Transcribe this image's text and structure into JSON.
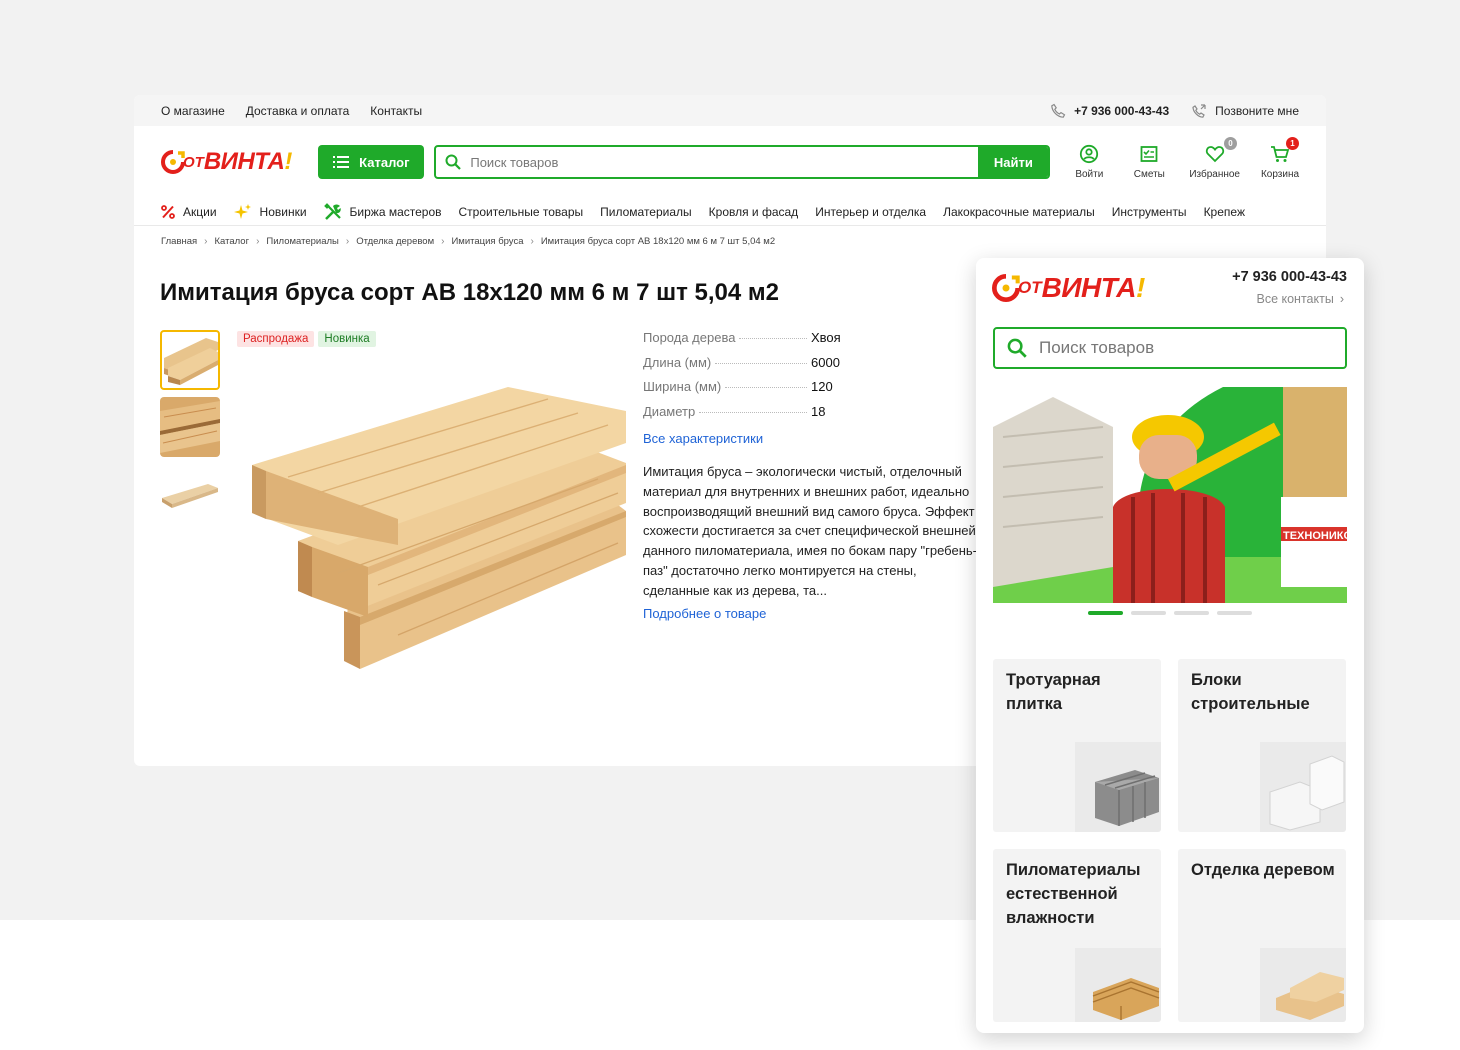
{
  "desktop": {
    "topbar": {
      "links": [
        "О магазине",
        "Доставка и оплата",
        "Контакты"
      ],
      "phone": "+7 936 000-43-43",
      "callback": "Позвоните мне"
    },
    "header": {
      "logo": {
        "ot": "ОТ",
        "vinta": "ВИНТА",
        "excl": "!"
      },
      "catalog_label": "Каталог",
      "search_placeholder": "Поиск товаров",
      "find_label": "Найти",
      "actions": {
        "login": "Войти",
        "estimates": "Сметы",
        "favorites": "Избранное",
        "favorites_count": "0",
        "cart": "Корзина",
        "cart_count": "1"
      }
    },
    "nav": {
      "promo": "Акции",
      "news": "Новинки",
      "masters": "Биржа мастеров",
      "items": [
        "Строительные товары",
        "Пиломатериалы",
        "Кровля и фасад",
        "Интерьер и отделка",
        "Лакокрасочные материалы",
        "Инструменты",
        "Крепеж"
      ]
    },
    "breadcrumbs": [
      "Главная",
      "Каталог",
      "Пиломатериалы",
      "Отделка деревом",
      "Имитация бруса",
      "Имитация бруса сорт АВ 18х120 мм 6 м 7 шт 5,04 м2"
    ],
    "product": {
      "title": "Имитация бруса сорт АВ 18х120 мм 6 м 7 шт 5,04 м2",
      "tags": {
        "sale": "Распродажа",
        "new": "Новинка"
      },
      "specs": [
        {
          "key": "Порода дерева",
          "value": "Хвоя"
        },
        {
          "key": "Длина (мм)",
          "value": "6000"
        },
        {
          "key": "Ширина (мм)",
          "value": "120"
        },
        {
          "key": "Диаметр",
          "value": "18"
        }
      ],
      "all_specs_link": "Все характеристики",
      "description": "Имитация бруса – экологически чистый, отделочный материал для внутренних и внешних работ, идеально воспроизводящий внешний вид самого бруса. Эффект схожести достигается за счет специфической внешней данного пиломатериала, имея по бокам пару \"гребень-паз\" достаточно легко монтируется на стены, сделанные как из дерева, та...",
      "more_link": "Подробнее о товаре"
    }
  },
  "mobile": {
    "phone": "+7 936 000-43-43",
    "contacts_link": "Все контакты",
    "search_placeholder": "Поиск товаров",
    "banner_brand": "ТЕХНОНИКОЛЬ",
    "slides_total": 4,
    "slide_active": 1,
    "categories": [
      "Тротуарная плитка",
      "Блоки строительные",
      "Пиломатериалы естественной влажности",
      "Отделка деревом"
    ]
  },
  "colors": {
    "brand_green": "#1faa2a",
    "brand_red": "#e3201b",
    "brand_yellow": "#f5b800",
    "link_blue": "#1f63d6"
  }
}
